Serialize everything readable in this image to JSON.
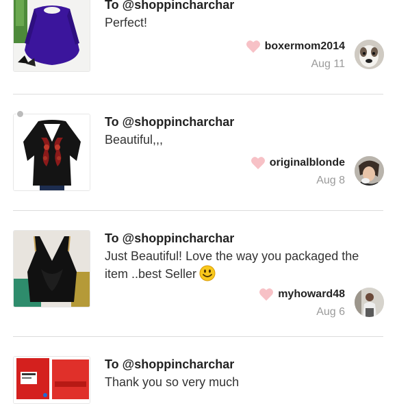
{
  "comments": [
    {
      "to": "To @shoppincharchar",
      "message": "Perfect!",
      "username": "boxermom2014",
      "date": "Aug 11",
      "has_emoji": false
    },
    {
      "to": "To @shoppincharchar",
      "message": "Beautiful,,,",
      "username": "originalblonde",
      "date": "Aug 8",
      "has_emoji": false
    },
    {
      "to": "To @shoppincharchar",
      "message": "Just Beautiful! Love the way you packaged the item ..best Seller",
      "username": "myhoward48",
      "date": "Aug 6",
      "has_emoji": true
    },
    {
      "to": "To @shoppincharchar",
      "message": "Thank you so very much",
      "username": "",
      "date": "",
      "has_emoji": false
    }
  ],
  "colors": {
    "heart": "#f7c1c6",
    "divider": "#dcdcdc",
    "date": "#9a9a9a"
  },
  "icons": {
    "like": "heart-icon",
    "emoji": "smiley-emoji-icon"
  }
}
